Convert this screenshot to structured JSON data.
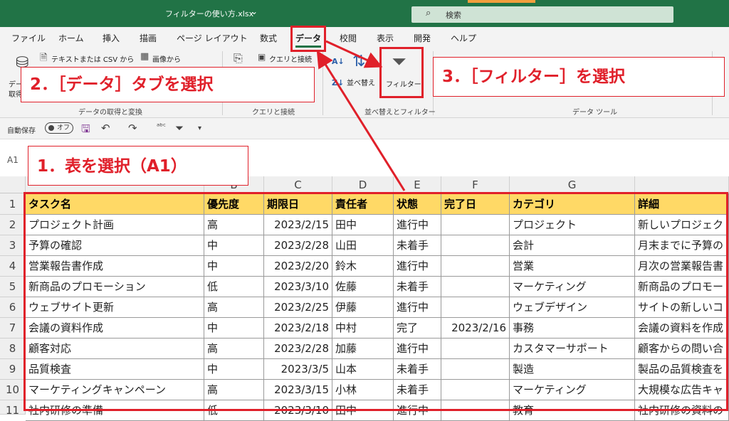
{
  "window": {
    "title": "フィルターの使い方.xlsx",
    "title_chevron": "⌄",
    "search_label": "検索"
  },
  "tabs": [
    "ファイル",
    "ホーム",
    "挿入",
    "描画",
    "ページ レイアウト",
    "数式",
    "データ",
    "校閲",
    "表示",
    "開発",
    "ヘルプ"
  ],
  "ribbon": {
    "text_csv": "テキストまたは CSV から",
    "from_image": "画像から",
    "query_connect": "クエリと接続",
    "data_get_short": "デー",
    "data_get_short2": "取得",
    "sort_label": "並べ替え",
    "filter_label": "フィルター",
    "group_labels": [
      "データの取得と変換",
      "クエリと接続",
      "並べ替えとフィルター",
      "データ ツール"
    ]
  },
  "qat": {
    "autosave": "自動保存",
    "toggle": "オフ"
  },
  "name_box": "A1",
  "columns": [
    "",
    "B",
    "C",
    "D",
    "E",
    "F",
    "G",
    ""
  ],
  "rows": [
    "1",
    "2",
    "3",
    "4",
    "5",
    "6",
    "7",
    "8",
    "9",
    "10",
    "11"
  ],
  "table": {
    "headers": [
      "タスク名",
      "優先度",
      "期限日",
      "責任者",
      "状態",
      "完了日",
      "カテゴリ",
      "詳細"
    ],
    "data": [
      [
        "プロジェクト計画",
        "高",
        "2023/2/15",
        "田中",
        "進行中",
        "",
        "プロジェクト",
        "新しいプロジェク"
      ],
      [
        "予算の確認",
        "中",
        "2023/2/28",
        "山田",
        "未着手",
        "",
        "会計",
        "月末までに予算の"
      ],
      [
        "営業報告書作成",
        "中",
        "2023/2/20",
        "鈴木",
        "進行中",
        "",
        "営業",
        "月次の営業報告書"
      ],
      [
        "新商品のプロモーション",
        "低",
        "2023/3/10",
        "佐藤",
        "未着手",
        "",
        "マーケティング",
        "新商品のプロモー"
      ],
      [
        "ウェブサイト更新",
        "高",
        "2023/2/25",
        "伊藤",
        "進行中",
        "",
        "ウェブデザイン",
        "サイトの新しいコ"
      ],
      [
        "会議の資料作成",
        "中",
        "2023/2/18",
        "中村",
        "完了",
        "2023/2/16",
        "事務",
        "会議の資料を作成"
      ],
      [
        "顧客対応",
        "高",
        "2023/2/28",
        "加藤",
        "進行中",
        "",
        "カスタマーサポート",
        "顧客からの問い合"
      ],
      [
        "品質検査",
        "中",
        "2023/3/5",
        "山本",
        "未着手",
        "",
        "製造",
        "製品の品質検査を"
      ],
      [
        "マーケティングキャンペーン",
        "高",
        "2023/3/15",
        "小林",
        "未着手",
        "",
        "マーケティング",
        "大規模な広告キャ"
      ],
      [
        "社内研修の準備",
        "低",
        "2023/3/10",
        "田中",
        "進行中",
        "",
        "教育",
        "社内研修の資料の"
      ]
    ]
  },
  "callouts": {
    "step1": "1．表を選択（A1）",
    "step2": "2．［データ］タブを選択",
    "step3": "3．［フィルター］を選択"
  },
  "colors": {
    "excel_green": "#217346",
    "header_fill": "#ffd966",
    "annotation_red": "#e0202a"
  }
}
